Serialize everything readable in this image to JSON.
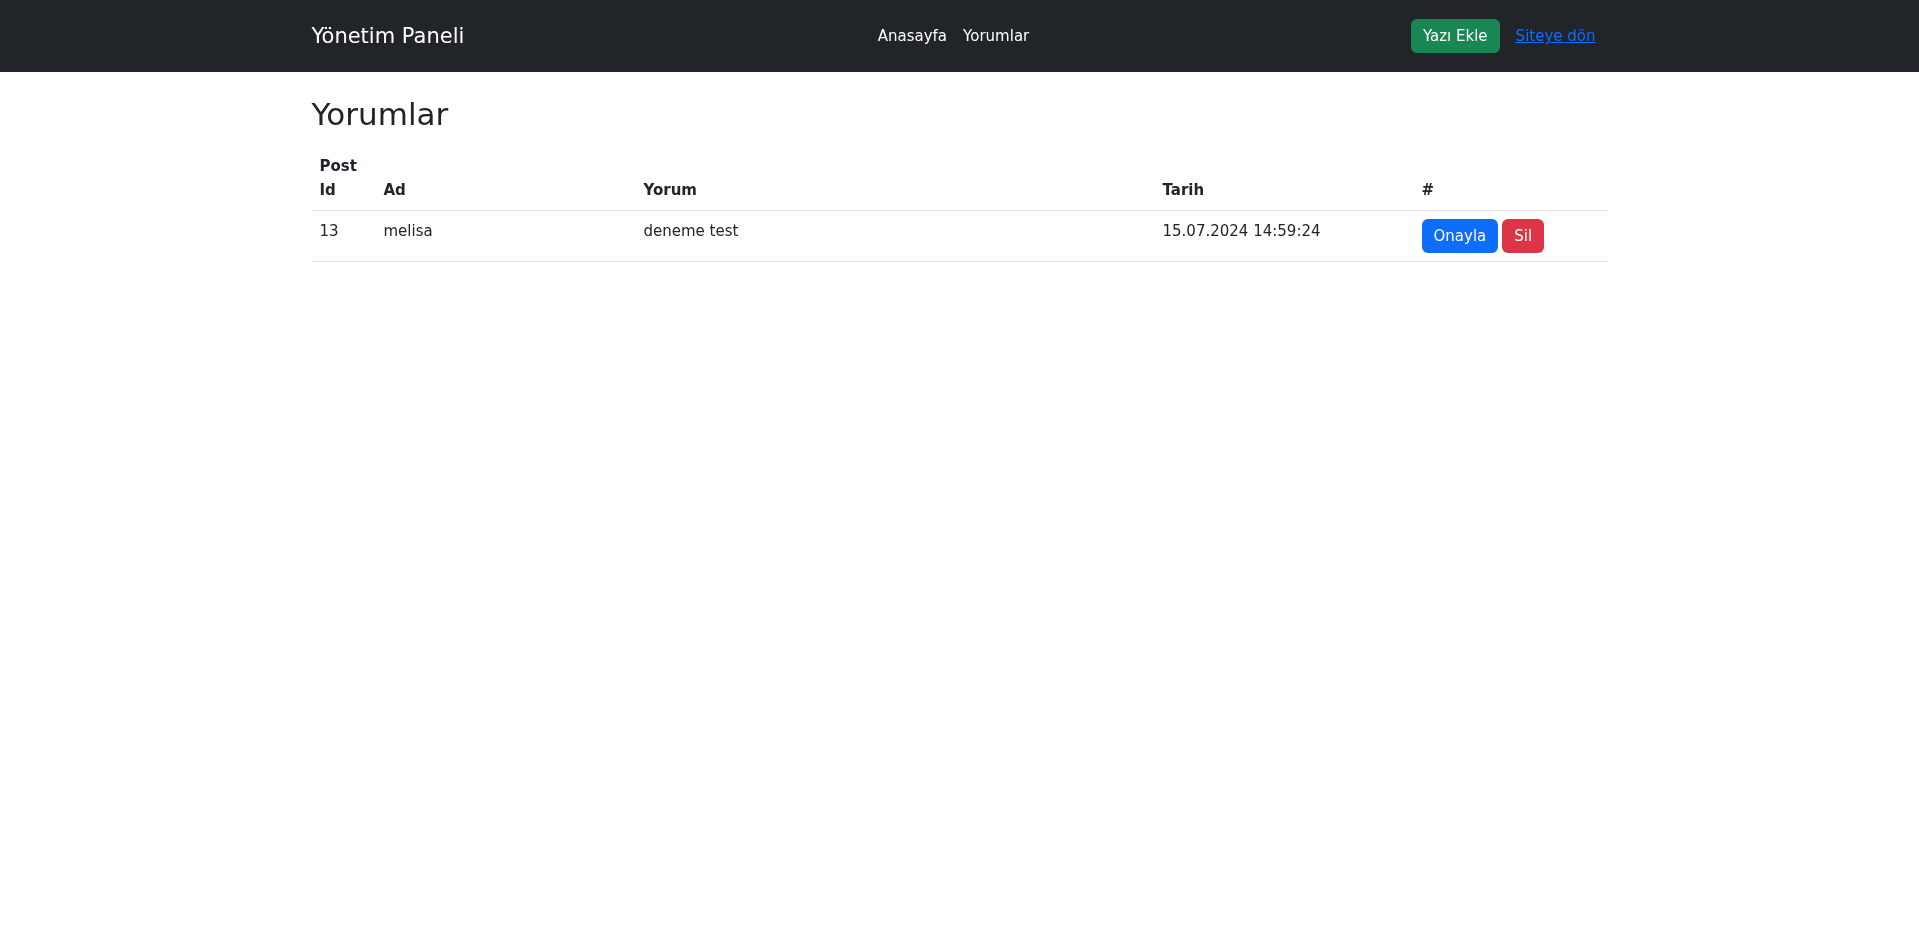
{
  "navbar": {
    "brand": "Yönetim Paneli",
    "links": [
      {
        "label": "Anasayfa"
      },
      {
        "label": "Yorumlar"
      }
    ],
    "add_button": "Yazı Ekle",
    "back_link": "Siteye dön"
  },
  "page_title": "Yorumlar",
  "table": {
    "columns": [
      "Post Id",
      "Ad",
      "Yorum",
      "Tarih",
      "#"
    ],
    "rows": [
      {
        "post_id": "13",
        "name": "melisa",
        "comment": "deneme test",
        "date": "15.07.2024 14:59:24",
        "actions": [
          {
            "label": "Onayla",
            "kind": "approve"
          },
          {
            "label": "Sil",
            "kind": "delete"
          }
        ]
      }
    ]
  }
}
